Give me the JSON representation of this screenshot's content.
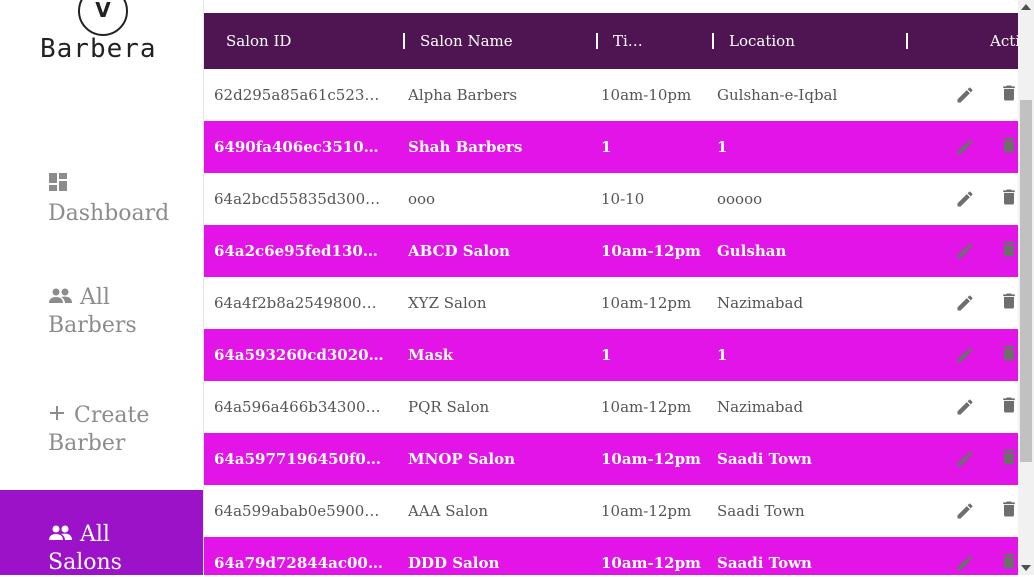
{
  "brand": {
    "logo_text": "Barbera",
    "logo_mark": "V"
  },
  "sidebar": {
    "items": [
      {
        "label": "Dashboard",
        "icon": "dashboard-icon",
        "active": false
      },
      {
        "label_line1": "All",
        "label_line2": "Barbers",
        "icon": "people-icon",
        "active": false
      },
      {
        "label_line1": "Create",
        "label_line2": "Barber",
        "icon": "plus-icon",
        "active": false
      },
      {
        "label_line1": "All",
        "label_line2": "Salons",
        "icon": "people-icon",
        "active": true
      }
    ]
  },
  "table": {
    "columns": [
      "Salon ID",
      "Salon Name",
      "Ti…",
      "Location",
      "Acti"
    ],
    "rows": [
      {
        "id": "62d295a85a61c523c04…",
        "name": "Alpha Barbers",
        "time": "10am-10pm",
        "location": "Gulshan-e-Iqbal"
      },
      {
        "id": "6490fa406ec351001c41…",
        "name": "Shah Barbers",
        "time": "1",
        "location": "1"
      },
      {
        "id": "64a2bcd55835d3001dd…",
        "name": "ooo",
        "time": "10-10",
        "location": "ooooo"
      },
      {
        "id": "64a2c6e95fed1300337c…",
        "name": "ABCD Salon",
        "time": "10am-12pm",
        "location": "Gulshan"
      },
      {
        "id": "64a4f2b8a25498001cb…",
        "name": "XYZ Salon",
        "time": "10am-12pm",
        "location": "Nazimabad"
      },
      {
        "id": "64a593260cd302001dc…",
        "name": "Mask",
        "time": "1",
        "location": "1"
      },
      {
        "id": "64a596a466b34300334…",
        "name": "PQR Salon",
        "time": "10am-12pm",
        "location": "Nazimabad"
      },
      {
        "id": "64a5977196450f001dc…",
        "name": "MNOP Salon",
        "time": "10am-12pm",
        "location": "Saadi Town"
      },
      {
        "id": "64a599abab0e59001d6…",
        "name": "AAA Salon",
        "time": "10am-12pm",
        "location": "Saadi Town"
      },
      {
        "id": "64a79d72844ac00031a…",
        "name": "DDD Salon",
        "time": "10am-12pm",
        "location": "Saadi Town"
      }
    ]
  },
  "colors": {
    "header_bg": "#4f1552",
    "highlight_row": "#e214e8",
    "sidebar_active": "#9b12c9",
    "icon_gray": "#6e6e6e"
  }
}
